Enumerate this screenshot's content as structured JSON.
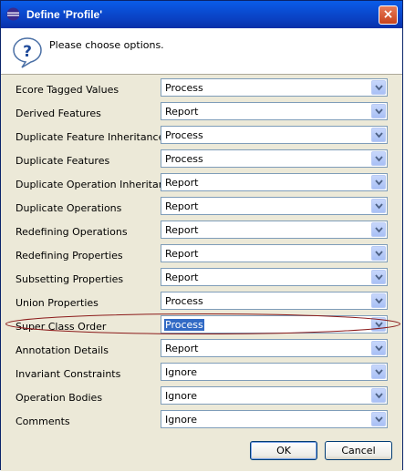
{
  "window": {
    "title": "Define 'Profile'"
  },
  "header": {
    "message": "Please choose options."
  },
  "options": [
    {
      "label": "Ecore Tagged Values",
      "value": "Process"
    },
    {
      "label": "Derived Features",
      "value": "Report"
    },
    {
      "label": "Duplicate Feature Inheritance",
      "value": "Process"
    },
    {
      "label": "Duplicate Features",
      "value": "Process"
    },
    {
      "label": "Duplicate Operation Inheritance",
      "value": "Report"
    },
    {
      "label": "Duplicate Operations",
      "value": "Report"
    },
    {
      "label": "Redefining Operations",
      "value": "Report"
    },
    {
      "label": "Redefining Properties",
      "value": "Report"
    },
    {
      "label": "Subsetting Properties",
      "value": "Report"
    },
    {
      "label": "Union Properties",
      "value": "Process"
    },
    {
      "label": "Super Class Order",
      "value": "Process"
    },
    {
      "label": "Annotation Details",
      "value": "Report"
    },
    {
      "label": "Invariant Constraints",
      "value": "Ignore"
    },
    {
      "label": "Operation Bodies",
      "value": "Ignore"
    },
    {
      "label": "Comments",
      "value": "Ignore"
    }
  ],
  "buttons": {
    "ok": "OK",
    "cancel": "Cancel"
  },
  "colors": {
    "titlebar": "#0a3fc0",
    "selection": "#316ac5",
    "highlight_ellipse": "#8b1a1a"
  }
}
